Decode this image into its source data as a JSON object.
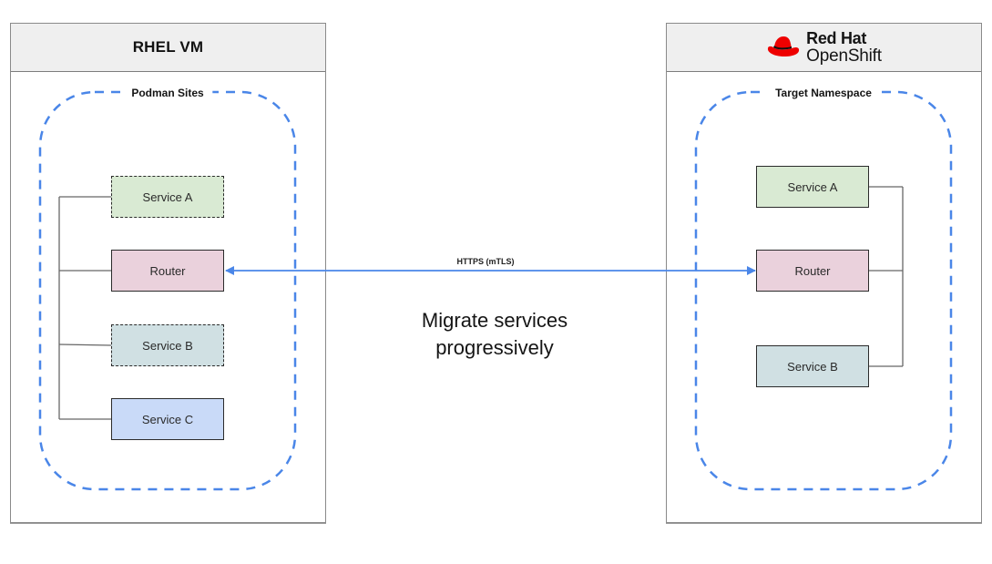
{
  "left_panel": {
    "title": "RHEL VM",
    "region_label": "Podman Sites",
    "services": [
      {
        "label": "Service A",
        "border": "dashed",
        "fill": "#d9ead3"
      },
      {
        "label": "Router",
        "border": "solid",
        "fill": "#ead1dc"
      },
      {
        "label": "Service B",
        "border": "dashed",
        "fill": "#d0e0e3"
      },
      {
        "label": "Service C",
        "border": "solid",
        "fill": "#c9daf8"
      }
    ]
  },
  "right_panel": {
    "brand": {
      "logo_icon": "red-hat-fedora-icon",
      "line1": "Red Hat",
      "line2": "OpenShift",
      "logo_color": "#ee0000"
    },
    "region_label": "Target Namespace",
    "services": [
      {
        "label": "Service A",
        "border": "solid",
        "fill": "#d9ead3"
      },
      {
        "label": "Router",
        "border": "solid",
        "fill": "#ead1dc"
      },
      {
        "label": "Service B",
        "border": "solid",
        "fill": "#d0e0e3"
      }
    ]
  },
  "connection": {
    "label": "HTTPS (mTLS)",
    "direction": "bidirectional",
    "color": "#4a86e8"
  },
  "caption": {
    "line1": "Migrate services",
    "line2": "progressively"
  },
  "colors": {
    "region_border": "#4a86e8",
    "panel_header_bg": "#efefef",
    "connector_line": "#666666"
  }
}
